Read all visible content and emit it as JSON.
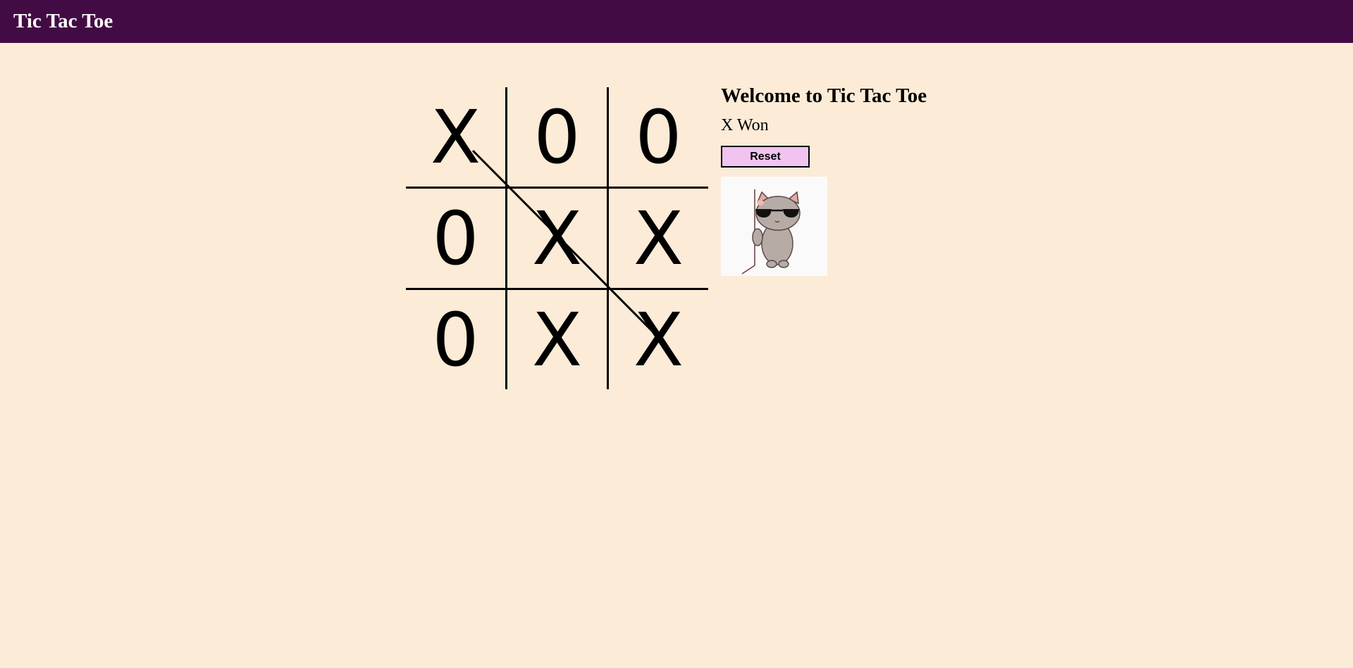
{
  "header": {
    "title": "Tic Tac Toe"
  },
  "board": {
    "cells": [
      "X",
      "0",
      "0",
      "0",
      "X",
      "X",
      "0",
      "X",
      "X"
    ],
    "winning_line": "diagonal-top-left-to-bottom-right"
  },
  "info": {
    "welcome": "Welcome to Tic Tac Toe",
    "status": "X Won",
    "reset_label": "Reset",
    "image": {
      "description": "cool-cat-gif",
      "icon": "cat-with-sunglasses-icon"
    }
  },
  "colors": {
    "navbar_bg": "#430b44",
    "page_bg": "#fbebd7",
    "reset_bg": "#f1c3ef",
    "text": "#000000"
  }
}
